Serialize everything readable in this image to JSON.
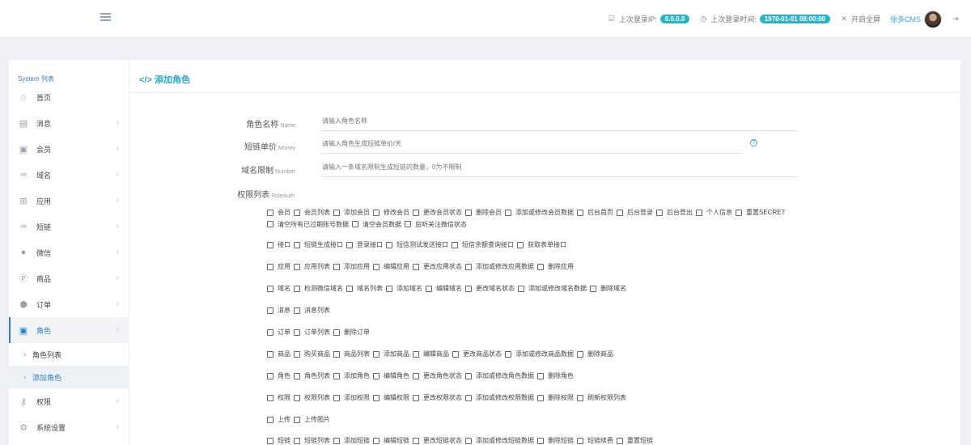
{
  "header": {
    "last_ip_label": "上次登录IP:",
    "last_ip_value": "0.0.0.0",
    "last_time_label": "上次登录时间:",
    "last_time_value": "1970-01-01 08:00:00",
    "fullscreen_label": "开启全屏",
    "brand": "徐多CMS"
  },
  "sidebar": {
    "title": "System 列表",
    "items": [
      {
        "label": "首页",
        "icon": "home-icon"
      },
      {
        "label": "消息",
        "icon": "file-icon"
      },
      {
        "label": "会员",
        "icon": "lock-icon"
      },
      {
        "label": "域名",
        "icon": "link-icon"
      },
      {
        "label": "应用",
        "icon": "gift-icon"
      },
      {
        "label": "短链",
        "icon": "link-icon"
      },
      {
        "label": "微信",
        "icon": "wechat-icon"
      },
      {
        "label": "商品",
        "icon": "product-icon"
      },
      {
        "label": "订单",
        "icon": "order-icon"
      },
      {
        "label": "角色",
        "icon": "lock-icon"
      },
      {
        "label": "权限",
        "icon": "key-icon"
      },
      {
        "label": "系统设置",
        "icon": "gears-icon"
      }
    ],
    "sub_items": [
      "角色列表",
      "添加角色"
    ]
  },
  "main": {
    "title": "添加角色",
    "fields": [
      {
        "label": "角色名称",
        "en": "Name",
        "placeholder": "请输入角色名称"
      },
      {
        "label": "短链单价",
        "en": "Money",
        "placeholder": "请输入角色生成短链单价/天"
      },
      {
        "label": "域名限制",
        "en": "Number",
        "placeholder": "请输入一条域名限制生成短链的数量，0为不限制"
      }
    ],
    "perm_label": "权限列表",
    "perm_en": "RoleAuth",
    "perm_groups": [
      [
        "会员",
        "会员列表",
        "添加会员",
        "修改会员",
        "更改会员状态",
        "删除会员",
        "添加或修改会员数据",
        "后台首页",
        "后台登录",
        "后台登出",
        "个人信息",
        "重置SECRET",
        "清空所有已过期账号数据",
        "清空会员数据",
        "监听关注微信状态"
      ],
      [
        "接口",
        "短链生成接口",
        "登录接口",
        "短信测试发送接口",
        "短信余额查询接口",
        "获取表单接口"
      ],
      [
        "应用",
        "应用列表",
        "添加应用",
        "编辑应用",
        "更改应用状态",
        "添加或修改应用数据",
        "删除应用"
      ],
      [
        "域名",
        "检测微信域名",
        "域名列表",
        "添加域名",
        "编辑域名",
        "更改域名状态",
        "添加或修改域名数据",
        "删除域名"
      ],
      [
        "消息",
        "消息列表"
      ],
      [
        "订单",
        "订单列表",
        "删除订单"
      ],
      [
        "商品",
        "购买商品",
        "商品列表",
        "添加商品",
        "编辑商品",
        "更改商品状态",
        "添加或修改商品数据",
        "删除商品"
      ],
      [
        "角色",
        "角色列表",
        "添加角色",
        "编辑角色",
        "更改角色状态",
        "添加或修改角色数据",
        "删除角色"
      ],
      [
        "权限",
        "权限列表",
        "添加权限",
        "编辑权限",
        "更改权限状态",
        "添加或修改权限数据",
        "删除权限",
        "刷新权限列表"
      ],
      [
        "上传",
        "上传图片"
      ],
      [
        "短链",
        "短链列表",
        "添加短链",
        "编辑短链",
        "更改短链状态",
        "添加或修改短链数据",
        "删除短链",
        "短链续费",
        "重置短链"
      ]
    ]
  }
}
